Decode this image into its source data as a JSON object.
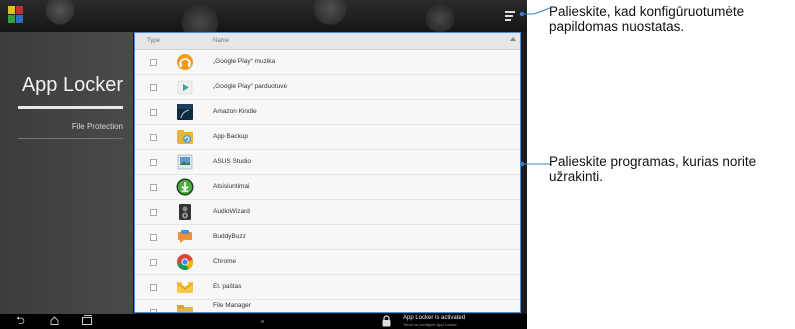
{
  "sidebar": {
    "title": "App Locker",
    "item": "File Protection"
  },
  "list": {
    "header": {
      "type_label": "Type",
      "name_label": "Name"
    },
    "rows": [
      {
        "label": "„Google Play“ muzika",
        "icon": "play-music-headphones-icon"
      },
      {
        "label": "„Google Play“ parduotuvė",
        "icon": "play-store-icon"
      },
      {
        "label": "Amazon Kindle",
        "icon": "kindle-icon"
      },
      {
        "label": "App Backup",
        "icon": "app-backup-icon"
      },
      {
        "label": "ASUS Studio",
        "icon": "asus-studio-icon"
      },
      {
        "label": "Atsisiuntimai",
        "icon": "downloads-icon"
      },
      {
        "label": "AudioWizard",
        "icon": "audiowizard-icon"
      },
      {
        "label": "BuddyBuzz",
        "icon": "buddybuzz-icon"
      },
      {
        "label": "Chrome",
        "icon": "chrome-icon"
      },
      {
        "label": "El. paštas",
        "icon": "email-icon"
      },
      {
        "label": "File Manager",
        "icon": "file-manager-icon"
      }
    ]
  },
  "statusbar": {
    "title": "App Locker is activated",
    "subtitle": "Touch to configure App Locker"
  },
  "callouts": {
    "settings": "Palieskite, kad konfigūruotumėte papildomas nuostatas.",
    "apps": "Palieskite programas, kurias norite užrakinti."
  },
  "colors": {
    "highlight": "#4a90d9",
    "callout_line": "#3a7fc4"
  }
}
